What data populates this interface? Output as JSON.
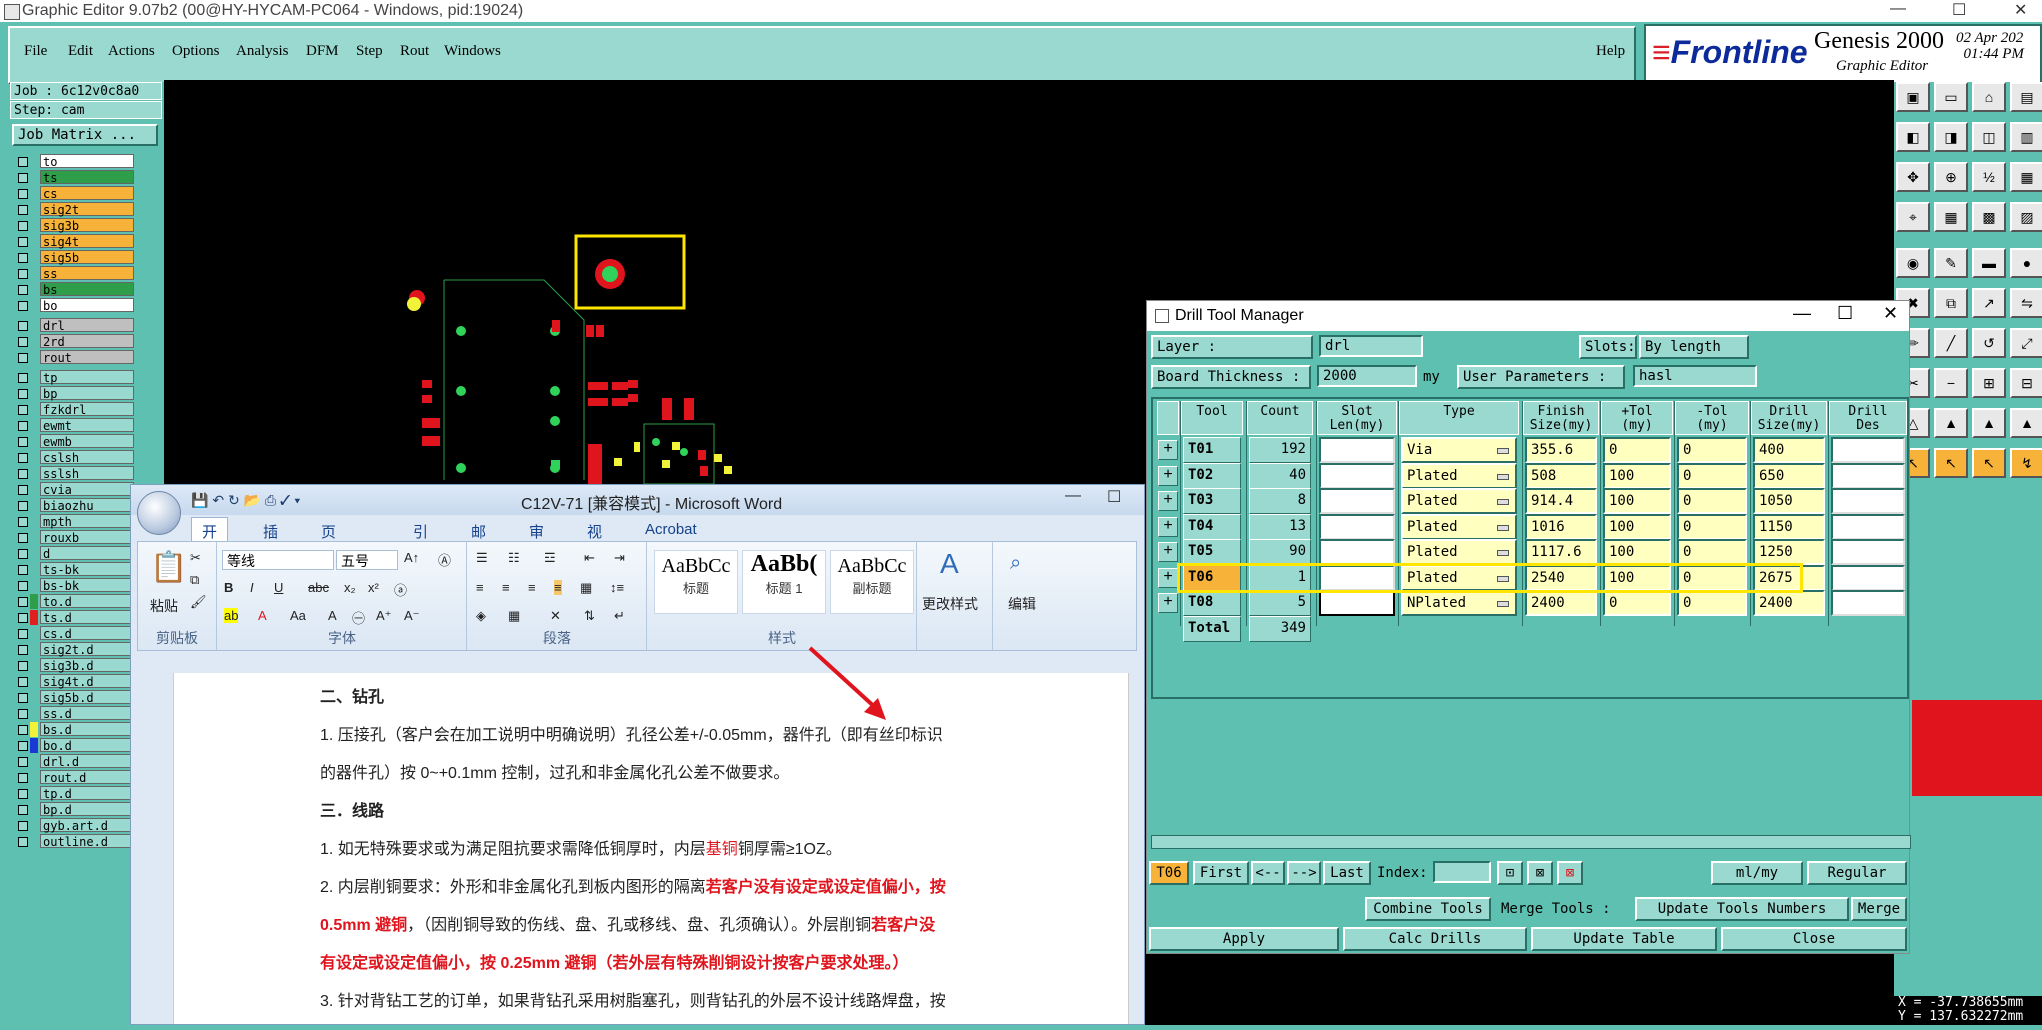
{
  "genesis": {
    "window_title": "Graphic Editor 9.07b2 (00@HY-HYCAM-PC064 - Windows, pid:19024)",
    "menu": [
      "File",
      "Edit",
      "Actions",
      "Options",
      "Analysis",
      "DFM",
      "Step",
      "Rout",
      "Windows"
    ],
    "help": "Help",
    "brand": {
      "logo": "Frontline",
      "product": "Genesis 2000",
      "subtitle": "Graphic Editor",
      "date": "02 Apr 202",
      "time": "01:44 PM"
    },
    "job": "Job : 6c12v0c8a0",
    "step": "Step: cam",
    "job_matrix": "Job Matrix ...",
    "layers": [
      {
        "name": "to",
        "color": "#ffffff"
      },
      {
        "name": "ts",
        "color": "#2e9e4a"
      },
      {
        "name": "cs",
        "color": "#f7b23a"
      },
      {
        "name": "sig2t",
        "color": "#f7b23a"
      },
      {
        "name": "sig3b",
        "color": "#f7b23a"
      },
      {
        "name": "sig4t",
        "color": "#f7b23a"
      },
      {
        "name": "sig5b",
        "color": "#f7b23a"
      },
      {
        "name": "ss",
        "color": "#f7b23a"
      },
      {
        "name": "bs",
        "color": "#2e9e4a"
      },
      {
        "name": "bo",
        "color": "#ffffff"
      },
      {
        "name": "drl",
        "color": "#bfbfbf"
      },
      {
        "name": "2rd",
        "color": "#bfbfbf"
      },
      {
        "name": "rout",
        "color": "#bfbfbf"
      },
      {
        "name": "tp",
        "color": "#9ad9d0"
      },
      {
        "name": "bp",
        "color": "#9ad9d0"
      },
      {
        "name": "fzkdrl",
        "color": "#9ad9d0"
      },
      {
        "name": "ewmt",
        "color": "#9ad9d0"
      },
      {
        "name": "ewmb",
        "color": "#9ad9d0"
      },
      {
        "name": "cslsh",
        "color": "#9ad9d0"
      },
      {
        "name": "sslsh",
        "color": "#9ad9d0"
      },
      {
        "name": "cvia",
        "color": "#9ad9d0"
      },
      {
        "name": "biaozhu",
        "color": "#9ad9d0"
      },
      {
        "name": "mpth",
        "color": "#9ad9d0"
      },
      {
        "name": "rouxb",
        "color": "#9ad9d0"
      },
      {
        "name": "d",
        "color": "#9ad9d0"
      },
      {
        "name": "ts-bk",
        "color": "#9ad9d0"
      },
      {
        "name": "bs-bk",
        "color": "#9ad9d0"
      },
      {
        "name": "to.d",
        "color": "#9ad9d0",
        "swatch": "#2e9e4a"
      },
      {
        "name": "ts.d",
        "color": "#9ad9d0",
        "swatch": "#e02020"
      },
      {
        "name": "cs.d",
        "color": "#9ad9d0"
      },
      {
        "name": "sig2t.d",
        "color": "#9ad9d0"
      },
      {
        "name": "sig3b.d",
        "color": "#9ad9d0"
      },
      {
        "name": "sig4t.d",
        "color": "#9ad9d0"
      },
      {
        "name": "sig5b.d",
        "color": "#9ad9d0"
      },
      {
        "name": "ss.d",
        "color": "#9ad9d0"
      },
      {
        "name": "bs.d",
        "color": "#9ad9d0",
        "swatch": "#f2f23a"
      },
      {
        "name": "bo.d",
        "color": "#9ad9d0",
        "swatch": "#1a3ad6"
      },
      {
        "name": "drl.d",
        "color": "#9ad9d0"
      },
      {
        "name": "rout.d",
        "color": "#9ad9d0"
      },
      {
        "name": "tp.d",
        "color": "#9ad9d0"
      },
      {
        "name": "bp.d",
        "color": "#9ad9d0"
      },
      {
        "name": "gyb.art.d",
        "color": "#9ad9d0"
      },
      {
        "name": "outline.d",
        "color": "#9ad9d0"
      }
    ],
    "coords": {
      "x": "X = -37.738655mm",
      "y": "Y = 137.632272mm"
    }
  },
  "word": {
    "title": "C12V-71 [兼容模式] - Microsoft Word",
    "tabs": [
      "开始",
      "插入",
      "页面布局",
      "引用",
      "邮件",
      "审阅",
      "视图",
      "Acrobat"
    ],
    "font_name": "等线",
    "font_size": "五号",
    "groups": {
      "clipboard": "剪贴板",
      "font": "字体",
      "paragraph": "段落",
      "styles": "样式"
    },
    "paste": "粘贴",
    "styles": [
      {
        "sample": "AaBbCc",
        "label": "标题"
      },
      {
        "sample": "AaBb(",
        "label": "标题 1"
      },
      {
        "sample": "AaBbCc",
        "label": "副标题"
      }
    ],
    "change_styles": "更改样式",
    "edit": "编辑",
    "doc": {
      "h1": "二、钻孔",
      "p1a": "1. 压接孔（客户会在加工说明中明确说明）孔径公差+/-0.05mm，器件孔（即有丝印标识",
      "p1b": "的器件孔）按 0~+0.1mm 控制，过孔和非金属化孔公差不做要求。",
      "h2": "三．线路",
      "p2_pre": "1. 如无特殊要求或为满足阻抗要求需降低铜厚时，内层",
      "p2_red": "基铜",
      "p2_post": "铜厚需≥1OZ。",
      "p3_pre": "2. 内层削铜要求：外形和非金属化孔到板内图形的隔离",
      "p3_red": "若客户没有设定或设定值偏小，按",
      "p4_red": "0.5mm 避铜",
      "p4_post": "，（因削铜导致的伤线、盘、孔或移线、盘、孔须确认）。外层削铜",
      "p4_red2": "若客户没",
      "p5_red": "有设定或设定值偏小，按 0.25mm 避铜（若外层有特殊削铜设计按客户要求处理。）",
      "p6": "3. 针对背钻工艺的订单，如果背钻孔采用树脂塞孔，则背钻孔的外层不设计线路焊盘，按"
    }
  },
  "dtm": {
    "title": "Drill Tool Manager",
    "layer_label": "Layer         :",
    "layer_value": "drl",
    "slots_label": "Slots:",
    "slots_value": "By length",
    "thickness_label": "Board Thickness :",
    "thickness_value": "2000",
    "thickness_unit": "my",
    "user_params_label": "User Parameters :",
    "user_params_value": "hasl",
    "headers": [
      "Tool",
      "Count",
      "Slot\nLen(my)",
      "Type",
      "Finish\nSize(my)",
      "+Tol\n(my)",
      "-Tol\n(my)",
      "Drill\nSize(my)",
      "Drill\nDes"
    ],
    "rows": [
      {
        "tool": "T01",
        "count": "192",
        "type": "Via",
        "finish": "355.6",
        "ptol": "0",
        "mtol": "0",
        "drill": "400"
      },
      {
        "tool": "T02",
        "count": "40",
        "type": "Plated",
        "finish": "508",
        "ptol": "100",
        "mtol": "0",
        "drill": "650"
      },
      {
        "tool": "T03",
        "count": "8",
        "type": "Plated",
        "finish": "914.4",
        "ptol": "100",
        "mtol": "0",
        "drill": "1050"
      },
      {
        "tool": "T04",
        "count": "13",
        "type": "Plated",
        "finish": "1016",
        "ptol": "100",
        "mtol": "0",
        "drill": "1150"
      },
      {
        "tool": "T05",
        "count": "90",
        "type": "Plated",
        "finish": "1117.6",
        "ptol": "100",
        "mtol": "0",
        "drill": "1250"
      },
      {
        "tool": "T06",
        "count": "1",
        "type": "Plated",
        "finish": "2540",
        "ptol": "100",
        "mtol": "0",
        "drill": "2675"
      },
      {
        "tool": "T08",
        "count": "5",
        "type": "NPlated",
        "finish": "2400",
        "ptol": "0",
        "mtol": "0",
        "drill": "2400"
      }
    ],
    "total_label": "Total",
    "total_count": "349",
    "current_tool": "T06",
    "nav": {
      "first": "First",
      "prev": "<--",
      "next": "-->",
      "last": "Last",
      "index": "Index:"
    },
    "units": "ml/my",
    "mode": "Regular",
    "combine": "Combine Tools",
    "merge_label": "Merge Tools :",
    "merge_value": "Update Tools Numbers",
    "merge_btn": "Merge",
    "apply": "Apply",
    "calc": "Calc Drills",
    "update": "Update Table",
    "close": "Close"
  },
  "colors": {
    "teal": "#5ec0b0",
    "teal_light": "#9ad9d0",
    "cream": "#ffffc0",
    "highlight": "#ffe600",
    "selected_tool": "#f7b23a"
  }
}
